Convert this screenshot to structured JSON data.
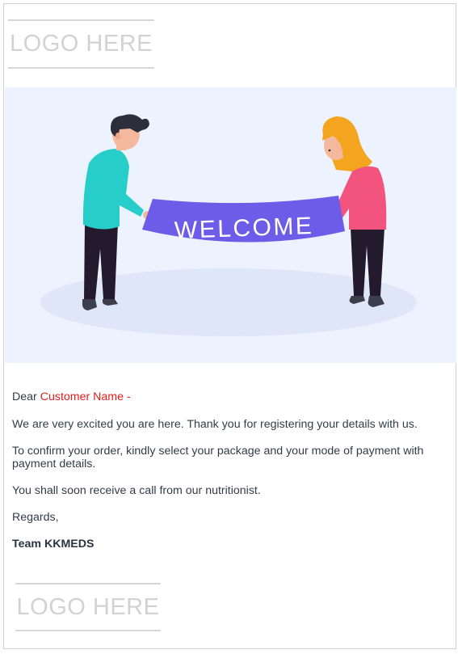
{
  "logo_top": {
    "text": "LOGO HERE"
  },
  "hero": {
    "banner_text": "WELCOME",
    "colors": {
      "background": "#ecf2fe",
      "banner": "#6c5ce7",
      "man_shirt": "#27cdc9",
      "woman_shirt": "#f2547d",
      "woman_hair": "#f3a51f",
      "pants": "#231a2e",
      "ground": "#dfe6f8"
    }
  },
  "email": {
    "greeting_prefix": "Dear",
    "customer_name": "Customer Name -",
    "paragraph_1": "We are very excited you are here. Thank you for registering your details with us.",
    "paragraph_2": "To confirm your order, kindly select your package and your mode of payment with payment details.",
    "paragraph_3": "You shall soon receive a call from our nutritionist.",
    "regards": "Regards,",
    "signature": "Team KKMEDS"
  },
  "logo_bottom": {
    "text": "LOGO HERE"
  }
}
